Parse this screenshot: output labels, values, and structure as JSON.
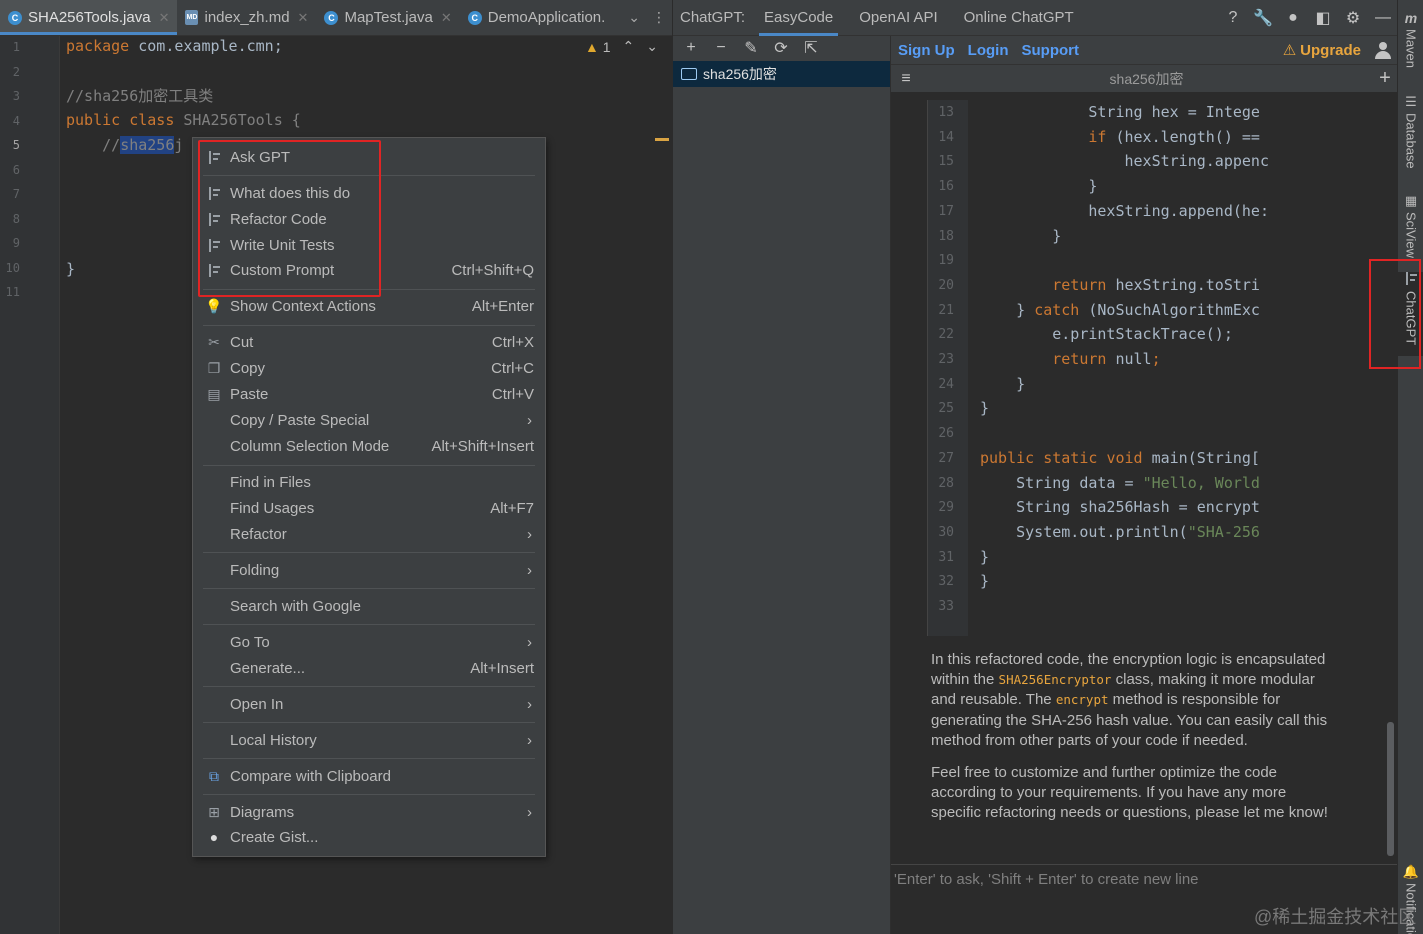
{
  "editor": {
    "tabs": [
      {
        "label": "SHA256Tools.java",
        "icon": "java-class-icon",
        "active": true
      },
      {
        "label": "index_zh.md",
        "icon": "markdown-icon"
      },
      {
        "label": "MapTest.java",
        "icon": "java-class-icon"
      },
      {
        "label": "DemoApplication.",
        "icon": "java-class-icon"
      }
    ],
    "warning_count": "1",
    "line_numbers": [
      "1",
      "2",
      "3",
      "4",
      "5",
      "6",
      "7",
      "8",
      "9",
      "10",
      "11"
    ],
    "code": {
      "l1_kw": "package",
      "l1_rest": " com.example.cmn;",
      "l3": "//sha256加密工具类",
      "l4_kw1": "public",
      "l4_kw2": "class",
      "l4_rest": " SHA256Tools {",
      "l5_pre": "    //",
      "l5_sel": "sha256",
      "l5_rest": "j",
      "l10": "}"
    }
  },
  "context_menu": {
    "items": [
      {
        "label": "Ask GPT",
        "icon": "chatgpt-icon"
      },
      {
        "label": "What does this do",
        "icon": "chatgpt-icon"
      },
      {
        "label": "Refactor Code",
        "icon": "chatgpt-icon"
      },
      {
        "label": "Write Unit Tests",
        "icon": "chatgpt-icon"
      },
      {
        "label": "Custom Prompt",
        "icon": "chatgpt-icon",
        "shortcut": "Ctrl+Shift+Q"
      },
      {
        "label": "Show Context Actions",
        "icon": "lightbulb-icon",
        "shortcut": "Alt+Enter"
      },
      {
        "label": "Cut",
        "icon": "scissors-icon",
        "shortcut": "Ctrl+X"
      },
      {
        "label": "Copy",
        "icon": "copy-icon",
        "shortcut": "Ctrl+C"
      },
      {
        "label": "Paste",
        "icon": "paste-icon",
        "shortcut": "Ctrl+V"
      },
      {
        "label": "Copy / Paste Special",
        "submenu": true
      },
      {
        "label": "Column Selection Mode",
        "shortcut": "Alt+Shift+Insert"
      },
      {
        "label": "Find in Files"
      },
      {
        "label": "Find Usages",
        "shortcut": "Alt+F7"
      },
      {
        "label": "Refactor",
        "submenu": true
      },
      {
        "label": "Folding",
        "submenu": true
      },
      {
        "label": "Search with Google"
      },
      {
        "label": "Go To",
        "submenu": true
      },
      {
        "label": "Generate...",
        "shortcut": "Alt+Insert"
      },
      {
        "label": "Open In",
        "submenu": true
      },
      {
        "label": "Local History",
        "submenu": true
      },
      {
        "label": "Compare with Clipboard",
        "icon": "compare-icon"
      },
      {
        "label": "Diagrams",
        "icon": "diagram-icon",
        "submenu": true
      },
      {
        "label": "Create Gist...",
        "icon": "github-icon"
      }
    ]
  },
  "tool_window": {
    "tabs": [
      {
        "label": "ChatGPT:"
      },
      {
        "label": "EasyCode",
        "active": true
      },
      {
        "label": "OpenAI API"
      },
      {
        "label": "Online ChatGPT"
      }
    ],
    "header_icons": [
      "help-icon",
      "wrench-icon",
      "github-icon",
      "toolwindow-icon",
      "gear-icon",
      "minimize-icon"
    ],
    "conversation_item": "sha256加密",
    "links": [
      "Sign Up",
      "Login",
      "Support"
    ],
    "upgrade_label": "Upgrade",
    "conversation_title": "sha256加密",
    "code_line_numbers": [
      "13",
      "14",
      "15",
      "16",
      "17",
      "18",
      "19",
      "20",
      "21",
      "22",
      "23",
      "24",
      "25",
      "26",
      "27",
      "28",
      "29",
      "30",
      "31",
      "32",
      "33"
    ],
    "code_lines": [
      "            String hex = Intege",
      "            if (hex.length() ==",
      "                hexString.appenc",
      "            }",
      "            hexString.append(he:",
      "        }",
      "",
      "        return hexString.toStri",
      "    } catch (NoSuchAlgorithmExc",
      "        e.printStackTrace();",
      "        return null;",
      "    }",
      "}",
      "",
      "public static void main(String[",
      "    String data = \"Hello, World",
      "    String sha256Hash = encrypt",
      "    System.out.println(\"SHA-256",
      "}",
      "}",
      ""
    ],
    "response": {
      "p1_a": "In this refactored code, the encryption logic is encapsulated within the ",
      "p1_code1": "SHA256Encryptor",
      "p1_b": " class, making it more modular and reusable. The ",
      "p1_code2": "encrypt",
      "p1_c": " method is responsible for generating the SHA-256 hash value. You can easily call this method from other parts of your code if needed.",
      "p2": "Feel free to customize and further optimize the code according to your requirements. If you have any more specific refactoring needs or questions, please let me know!"
    },
    "input_placeholder": "'Enter' to ask, 'Shift + Enter' to create new line"
  },
  "right_stripe": {
    "items": [
      "Maven",
      "Database",
      "SciView",
      "ChatGPT",
      "Notifications"
    ]
  },
  "watermark": "@稀土掘金技术社区"
}
